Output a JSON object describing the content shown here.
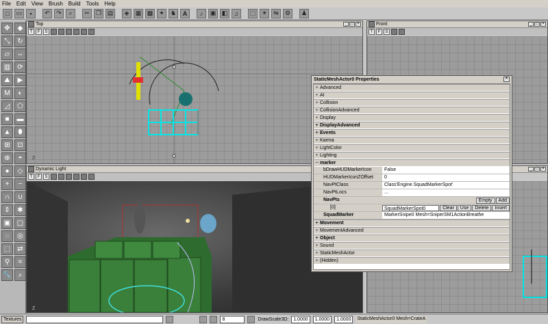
{
  "menu": [
    "File",
    "Edit",
    "View",
    "Brush",
    "Build",
    "Tools",
    "Help"
  ],
  "toolbar_icons": [
    "new-icon",
    "open-icon",
    "save-icon",
    "undo-icon",
    "redo-icon",
    "search-icon",
    "cut-icon",
    "copy-icon",
    "paste-icon",
    "actor-browser-icon",
    "group-icon",
    "texture-icon",
    "mesh-icon",
    "animation-icon",
    "a-icon",
    "sound-icon",
    "static-mesh-icon",
    "prefab-icon",
    "music-icon",
    "build-geometry-icon",
    "build-lighting-icon",
    "build-paths-icon",
    "build-all-icon",
    "play-icon"
  ],
  "viewports": {
    "top": {
      "title": "Top"
    },
    "front": {
      "title": "Front"
    },
    "dynamic": {
      "title": "Dynamic Light"
    }
  },
  "properties": {
    "window_title": "StaticMeshActor0 Properties",
    "close_glyph": "×",
    "categories_top": [
      "Advanced",
      "AI",
      "Collision",
      "CollisionAdvanced",
      "Display",
      "DisplayAdvanced",
      "Events",
      "Karma",
      "LightColor",
      "Lighting"
    ],
    "marker_category": "marker",
    "rows": [
      {
        "name": "bDrawHUDMarkerIcon",
        "value": "False"
      },
      {
        "name": "HUDMarkerIconZOffset",
        "value": "0"
      },
      {
        "name": "NavPtClass",
        "value": "Class'Engine.SquadMarkerSpot'"
      },
      {
        "name": "NavPtLocs",
        "value": "..."
      }
    ],
    "navpts": {
      "label": "NavPts",
      "empty_btn": "Empty",
      "add_btn": "Add"
    },
    "navpt_entry": {
      "index": "[0]",
      "value": "SquadMarkerSpot0",
      "clear_btn": "Clear",
      "use_btn": "Use",
      "delete_btn": "Delete",
      "insert_btn": "Insert"
    },
    "squad_marker": {
      "name": "SquadMarker",
      "value": "MarkerSnipe0 Mesh=SniperSM1ActionBreathe"
    },
    "categories_bottom": [
      "Movement",
      "MovementAdvanced",
      "Object",
      "Sound",
      "StaticMeshActor",
      "(Hidden)"
    ]
  },
  "status": {
    "textures_tab": "Textures",
    "draw_scale_label": "DrawScale3D:",
    "grid_value": "8",
    "scale_x": "1.0000",
    "scale_y": "1.0000",
    "scale_z": "1.0000",
    "selection": "StaticMeshActor0 Mesh=CrateA"
  }
}
